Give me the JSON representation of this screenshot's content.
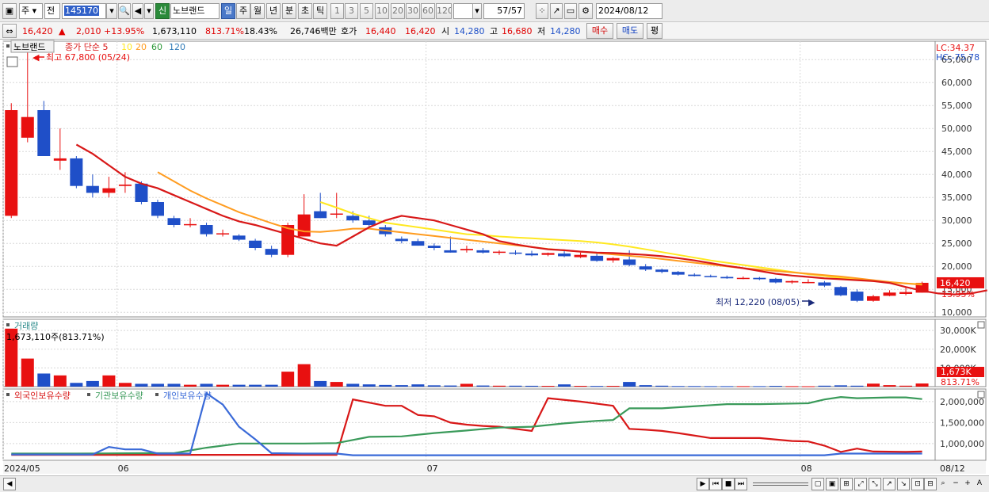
{
  "toolbar": {
    "market_type": "주",
    "prev_label": "전",
    "stock_code": "145170",
    "new_badge": "신",
    "stock_name": "노브랜드",
    "periods": [
      "일",
      "주",
      "월",
      "년",
      "분",
      "초",
      "틱"
    ],
    "intervals": [
      "1",
      "3",
      "5",
      "10",
      "20",
      "30",
      "60",
      "120"
    ],
    "page_count": "57",
    "page_total": "/57",
    "date_value": "2024/08/12"
  },
  "info": {
    "price": "16,420",
    "change": "2,010",
    "change_pct": "+13.95%",
    "volume": "1,673,110",
    "vol_ratio": "813.71%",
    "turnover": "18.43%",
    "amount": "26,746백만",
    "hoga_label": "호가",
    "ask": "16,440",
    "bid": "16,420",
    "open_label": "시",
    "open": "14,280",
    "high_label": "고",
    "high": "16,680",
    "low_label": "저",
    "low": "14,280",
    "buy_label": "매수",
    "sell_label": "매도",
    "eval_label": "평"
  },
  "colors": {
    "up": "#e81010",
    "down": "#1f4fc8",
    "ma5": "#d81818",
    "ma10": "#ffe820",
    "ma20": "#ff9c20",
    "ma60": "#2e9a3a",
    "ma120": "#2f7ab8",
    "foreign": "#d81818",
    "institution": "#3a9a5a",
    "individual": "#3a6ad8"
  },
  "chart_data": [
    {
      "type": "candlestick",
      "title": "노브랜드",
      "legend": [
        "종가 단순 5",
        "10",
        "20",
        "60",
        "120"
      ],
      "ylim": [
        9000,
        69000
      ],
      "yticks": [
        10000,
        15000,
        20000,
        25000,
        30000,
        35000,
        40000,
        45000,
        50000,
        55000,
        60000,
        65000
      ],
      "ytick_labels": [
        "10,000",
        "15,000",
        "20,000",
        "25,000",
        "30,000",
        "35,000",
        "40,000",
        "45,000",
        "50,000",
        "55,000",
        "60,000",
        "65,000"
      ],
      "x_labels": [
        "2024/05",
        "06",
        "07",
        "08",
        "08/12"
      ],
      "lc_label": "LC:34.37",
      "hc_label": "HC:-75.78",
      "high_annotation": "최고 67,800 (05/24)",
      "low_annotation": "최저 12,220 (08/05)",
      "last_price_tag": "16,420",
      "last_change_tag": "13.95%",
      "candles": [
        {
          "o": 31000,
          "h": 55500,
          "l": 30500,
          "c": 54000
        },
        {
          "o": 48000,
          "h": 67800,
          "l": 47000,
          "c": 52500
        },
        {
          "o": 54000,
          "h": 56000,
          "l": 44000,
          "c": 44000
        },
        {
          "o": 43000,
          "h": 50000,
          "l": 41000,
          "c": 43500
        },
        {
          "o": 43500,
          "h": 44000,
          "l": 37000,
          "c": 37500
        },
        {
          "o": 37500,
          "h": 40000,
          "l": 35000,
          "c": 36000
        },
        {
          "o": 36000,
          "h": 39500,
          "l": 35000,
          "c": 37000
        },
        {
          "o": 37500,
          "h": 40500,
          "l": 36000,
          "c": 37800
        },
        {
          "o": 38000,
          "h": 38500,
          "l": 33500,
          "c": 34000
        },
        {
          "o": 34000,
          "h": 34500,
          "l": 30500,
          "c": 31000
        },
        {
          "o": 30500,
          "h": 31000,
          "l": 28500,
          "c": 29000
        },
        {
          "o": 29000,
          "h": 30500,
          "l": 28500,
          "c": 29200
        },
        {
          "o": 29000,
          "h": 29500,
          "l": 26500,
          "c": 27000
        },
        {
          "o": 27000,
          "h": 28000,
          "l": 26500,
          "c": 27200
        },
        {
          "o": 26700,
          "h": 27000,
          "l": 25500,
          "c": 25800
        },
        {
          "o": 25600,
          "h": 26000,
          "l": 23500,
          "c": 24000
        },
        {
          "o": 23800,
          "h": 24500,
          "l": 22000,
          "c": 22500
        },
        {
          "o": 22500,
          "h": 29500,
          "l": 22000,
          "c": 29000
        },
        {
          "o": 26500,
          "h": 35700,
          "l": 26500,
          "c": 31300
        },
        {
          "o": 32000,
          "h": 36000,
          "l": 30500,
          "c": 30500
        },
        {
          "o": 31300,
          "h": 36000,
          "l": 30500,
          "c": 31500
        },
        {
          "o": 31000,
          "h": 32000,
          "l": 29500,
          "c": 30000
        },
        {
          "o": 30000,
          "h": 31000,
          "l": 28500,
          "c": 29000
        },
        {
          "o": 28500,
          "h": 29000,
          "l": 26500,
          "c": 27000
        },
        {
          "o": 26000,
          "h": 26500,
          "l": 25000,
          "c": 25500
        },
        {
          "o": 25500,
          "h": 26000,
          "l": 24500,
          "c": 24500
        },
        {
          "o": 24500,
          "h": 25000,
          "l": 23500,
          "c": 24000
        },
        {
          "o": 23500,
          "h": 26500,
          "l": 23000,
          "c": 23000
        },
        {
          "o": 23500,
          "h": 24500,
          "l": 23000,
          "c": 23800
        },
        {
          "o": 23500,
          "h": 24000,
          "l": 22800,
          "c": 23000
        },
        {
          "o": 23000,
          "h": 23500,
          "l": 22500,
          "c": 23200
        },
        {
          "o": 23000,
          "h": 23500,
          "l": 22500,
          "c": 22800
        },
        {
          "o": 22800,
          "h": 23400,
          "l": 22200,
          "c": 22400
        },
        {
          "o": 22500,
          "h": 23000,
          "l": 22200,
          "c": 22900
        },
        {
          "o": 22800,
          "h": 23300,
          "l": 22000,
          "c": 22200
        },
        {
          "o": 22000,
          "h": 23000,
          "l": 21800,
          "c": 22500
        },
        {
          "o": 22300,
          "h": 22800,
          "l": 21000,
          "c": 21200
        },
        {
          "o": 21300,
          "h": 22000,
          "l": 20800,
          "c": 21800
        },
        {
          "o": 21500,
          "h": 23500,
          "l": 20000,
          "c": 20300
        },
        {
          "o": 20000,
          "h": 20500,
          "l": 19000,
          "c": 19300
        },
        {
          "o": 19300,
          "h": 19500,
          "l": 18500,
          "c": 18800
        },
        {
          "o": 18800,
          "h": 19000,
          "l": 18000,
          "c": 18200
        },
        {
          "o": 18200,
          "h": 18500,
          "l": 17800,
          "c": 17900
        },
        {
          "o": 17900,
          "h": 18200,
          "l": 17600,
          "c": 17700
        },
        {
          "o": 17700,
          "h": 18000,
          "l": 17300,
          "c": 17400
        },
        {
          "o": 17400,
          "h": 17800,
          "l": 17200,
          "c": 17500
        },
        {
          "o": 17500,
          "h": 17700,
          "l": 17000,
          "c": 17200
        },
        {
          "o": 17300,
          "h": 17500,
          "l": 16300,
          "c": 16500
        },
        {
          "o": 16500,
          "h": 17000,
          "l": 16200,
          "c": 16800
        },
        {
          "o": 16600,
          "h": 17200,
          "l": 16300,
          "c": 16600
        },
        {
          "o": 16500,
          "h": 16800,
          "l": 15500,
          "c": 15800
        },
        {
          "o": 15500,
          "h": 15700,
          "l": 13500,
          "c": 13700
        },
        {
          "o": 14500,
          "h": 15000,
          "l": 12220,
          "c": 12500
        },
        {
          "o": 12500,
          "h": 13800,
          "l": 12300,
          "c": 13500
        },
        {
          "o": 13600,
          "h": 14800,
          "l": 13500,
          "c": 14300
        },
        {
          "o": 14000,
          "h": 15500,
          "l": 13700,
          "c": 14410
        },
        {
          "o": 14280,
          "h": 16680,
          "l": 14280,
          "c": 16420
        }
      ],
      "ma5_start": 4,
      "ma5": [
        46500,
        44500,
        42000,
        39500,
        38000,
        37000,
        35500,
        34000,
        32500,
        31000,
        29800,
        29000,
        28000,
        27000,
        26000,
        25000,
        24500,
        26500,
        28500,
        30000,
        31000,
        30500,
        30000,
        29000,
        28000,
        27000,
        25500,
        24800,
        24200,
        23700,
        23500,
        23200,
        23000,
        22900,
        22700,
        22500,
        22200,
        21800,
        21300,
        20700,
        20100,
        19600,
        19000,
        18400,
        18000,
        17700,
        17400,
        17200,
        17000,
        16800,
        16400,
        15500,
        14700,
        14100,
        13900,
        14100,
        14800
      ],
      "ma10_start": 19,
      "ma10": [
        34000,
        32800,
        31500,
        30500,
        29500,
        29000,
        28500,
        28000,
        27500,
        27000,
        26800,
        26500,
        26300,
        26100,
        25900,
        25700,
        25500,
        25200,
        24800,
        24300,
        23700,
        23100,
        22500,
        21900,
        21300,
        20800,
        20300,
        19800,
        19300,
        18800,
        18300,
        17900,
        17500,
        17100,
        16800,
        16500,
        16300,
        16100
      ],
      "ma20_start": 9,
      "ma20": [
        40500,
        38500,
        36500,
        34800,
        33300,
        31800,
        30600,
        29400,
        28300,
        27600,
        27500,
        27800,
        28200,
        28200,
        27800,
        27400,
        27000,
        26600,
        26200,
        25800,
        25400,
        25000,
        24600,
        24200,
        23800,
        23500,
        23200,
        22900,
        22600,
        22300,
        22000,
        21600,
        21200,
        20800,
        20400,
        20000,
        19600,
        19300,
        19000,
        18700,
        18400,
        18100,
        17800,
        17400,
        17000,
        16600,
        16300,
        16000
      ]
    },
    {
      "type": "bar",
      "title": "거래량",
      "annotation": "1,673,110주(813.71%)",
      "ylim": [
        0,
        36000000
      ],
      "yticks": [
        10000000,
        20000000,
        30000000
      ],
      "ytick_labels": [
        "10,000K",
        "20,000K",
        "30,000K"
      ],
      "last_tag": "1,673K",
      "last_pct_tag": "813.71%",
      "values": [
        31000000,
        15000000,
        7000000,
        6000000,
        2000000,
        3000000,
        6000000,
        2000000,
        1500000,
        1500000,
        1500000,
        1000000,
        1500000,
        1000000,
        1000000,
        1000000,
        1000000,
        8000000,
        12000000,
        3000000,
        2500000,
        1500000,
        1200000,
        900000,
        800000,
        1200000,
        700000,
        600000,
        1500000,
        600000,
        500000,
        500000,
        450000,
        400000,
        1200000,
        400000,
        350000,
        400000,
        2500000,
        800000,
        500000,
        300000,
        300000,
        250000,
        250000,
        250000,
        250000,
        400000,
        250000,
        200000,
        500000,
        700000,
        500000,
        1600000,
        800000,
        500000,
        1673110
      ]
    },
    {
      "type": "line",
      "series_names": [
        "외국인보유수량",
        "기관보유수량",
        "개인보유수량"
      ],
      "ylim": [
        600000,
        2300000
      ],
      "yticks": [
        1000000,
        1500000,
        2000000
      ],
      "ytick_labels": [
        "1,000,000",
        "1,500,000",
        "2,000,000"
      ],
      "series": [
        {
          "name": "외국인보유수량",
          "points": [
            [
              0,
              730000
            ],
            [
              5,
              730000
            ],
            [
              10,
              730000
            ],
            [
              14,
              730000
            ],
            [
              20,
              730000
            ],
            [
              21,
              2050000
            ],
            [
              23,
              1900000
            ],
            [
              24,
              1900000
            ],
            [
              25,
              1680000
            ],
            [
              26,
              1650000
            ],
            [
              27,
              1500000
            ],
            [
              28,
              1450000
            ],
            [
              29,
              1420000
            ],
            [
              30,
              1400000
            ],
            [
              31,
              1350000
            ],
            [
              32,
              1300000
            ],
            [
              33,
              2080000
            ],
            [
              35,
              2000000
            ],
            [
              36,
              1950000
            ],
            [
              37,
              1900000
            ],
            [
              38,
              1350000
            ],
            [
              39,
              1330000
            ],
            [
              40,
              1300000
            ],
            [
              41,
              1250000
            ],
            [
              43,
              1130000
            ],
            [
              46,
              1130000
            ],
            [
              48,
              1060000
            ],
            [
              49,
              1050000
            ],
            [
              50,
              950000
            ],
            [
              51,
              800000
            ],
            [
              52,
              880000
            ],
            [
              53,
              810000
            ],
            [
              55,
              800000
            ],
            [
              56,
              810000
            ]
          ]
        },
        {
          "name": "기관보유수량",
          "points": [
            [
              0,
              760000
            ],
            [
              4,
              760000
            ],
            [
              8,
              770000
            ],
            [
              10,
              770000
            ],
            [
              12,
              900000
            ],
            [
              14,
              1000000
            ],
            [
              15,
              1000000
            ],
            [
              18,
              1000000
            ],
            [
              20,
              1010000
            ],
            [
              22,
              1160000
            ],
            [
              24,
              1170000
            ],
            [
              26,
              1250000
            ],
            [
              28,
              1310000
            ],
            [
              30,
              1380000
            ],
            [
              32,
              1400000
            ],
            [
              34,
              1480000
            ],
            [
              36,
              1540000
            ],
            [
              37,
              1560000
            ],
            [
              38,
              1840000
            ],
            [
              40,
              1840000
            ],
            [
              44,
              1940000
            ],
            [
              46,
              1940000
            ],
            [
              49,
              1960000
            ],
            [
              50,
              2050000
            ],
            [
              51,
              2110000
            ],
            [
              52,
              2080000
            ],
            [
              54,
              2100000
            ],
            [
              55,
              2100000
            ],
            [
              56,
              2060000
            ]
          ]
        },
        {
          "name": "개인보유수량",
          "points": [
            [
              0,
              740000
            ],
            [
              5,
              740000
            ],
            [
              6,
              920000
            ],
            [
              7,
              860000
            ],
            [
              8,
              860000
            ],
            [
              9,
              760000
            ],
            [
              10,
              760000
            ],
            [
              11,
              760000
            ],
            [
              12,
              2200000
            ],
            [
              13,
              1930000
            ],
            [
              14,
              1400000
            ],
            [
              15,
              1100000
            ],
            [
              16,
              770000
            ],
            [
              18,
              760000
            ],
            [
              20,
              760000
            ],
            [
              21,
              720000
            ],
            [
              25,
              720000
            ],
            [
              30,
              720000
            ],
            [
              35,
              720000
            ],
            [
              40,
              720000
            ],
            [
              45,
              720000
            ],
            [
              50,
              720000
            ],
            [
              51,
              760000
            ],
            [
              52,
              760000
            ],
            [
              56,
              760000
            ]
          ]
        }
      ]
    }
  ],
  "bottom": {
    "scroll_buttons": [
      "▶",
      "⏮",
      "■",
      "⏭"
    ],
    "zoom_minus": "−",
    "zoom_plus": "+",
    "auto_label": "A"
  }
}
